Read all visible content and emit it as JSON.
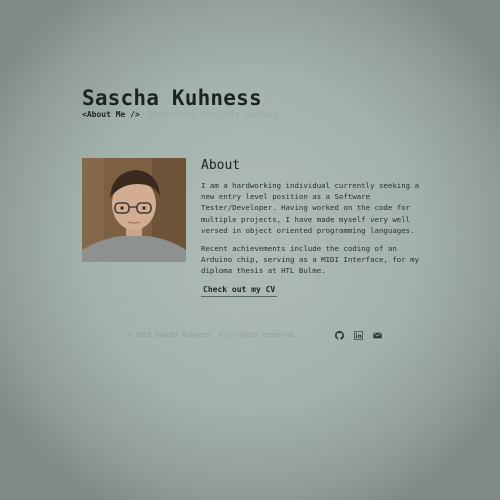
{
  "header": {
    "site_name": "Sascha Kuhness",
    "nav_active": "<About Me />",
    "nav_faint": "Experience  Projects  Contact"
  },
  "about": {
    "title": "About",
    "paragraph1": "I am a hardworking individual currently seeking a new entry level position as a Software Tester/Developer. Having worked on the code for multiple projects, I have made myself very well versed in object oriented programming languages.",
    "paragraph2": "Recent achievements include the coding of an Arduino chip, serving as a MIDI Interface, for my diploma thesis at HTL Bulme.",
    "cv_button": "Check out my CV",
    "avatar_icon": "profile-photo"
  },
  "footer": {
    "copyright": "© 2023 Sascha Kuhness. All rights reserved.",
    "social_icons": [
      "github-icon",
      "linkedin-icon",
      "mail-icon"
    ]
  },
  "colors": {
    "background": "#a4b2ad",
    "text": "#1f2422",
    "muted": "#8f9d98"
  }
}
